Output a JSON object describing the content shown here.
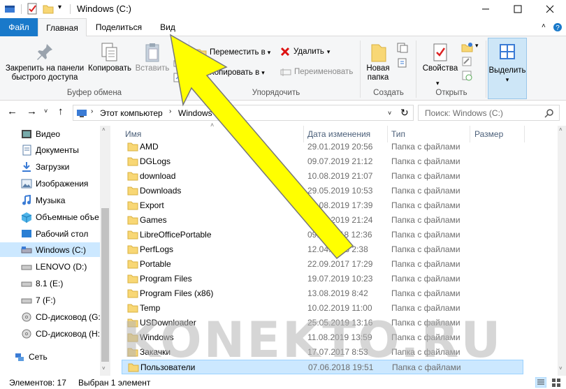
{
  "window": {
    "title": "Windows (C:)"
  },
  "tabs": {
    "file": "Файл",
    "home": "Главная",
    "share": "Поделиться",
    "view": "Вид"
  },
  "ribbon": {
    "pin": "Закрепить на панели быстрого доступа",
    "copy": "Копировать",
    "paste": "Вставить",
    "move_to": "Переместить в",
    "copy_to": "Копировать в",
    "delete": "Удалить",
    "rename": "Переименовать",
    "new_folder": "Новая папка",
    "properties": "Свойства",
    "select": "Выделить",
    "group_clipboard": "Буфер обмена",
    "group_organize": "Упорядочить",
    "group_create": "Создать",
    "group_open": "Открыть"
  },
  "address": {
    "parts": [
      "Этот компьютер",
      "Windows (C:)"
    ],
    "search_placeholder": "Поиск: Windows (C:)"
  },
  "nav": {
    "items": [
      "Видео",
      "Документы",
      "Загрузки",
      "Изображения",
      "Музыка",
      "Объемные объе",
      "Рабочий стол",
      "Windows (C:)",
      "LENOVO (D:)",
      "8.1 (E:)",
      "7 (F:)",
      "CD-дисковод (G:",
      "CD-дисковод (H:",
      "Сеть"
    ]
  },
  "columns": {
    "name": "Имя",
    "date": "Дата изменения",
    "type": "Тип",
    "size": "Размер"
  },
  "files": [
    {
      "name": "AMD",
      "date": "29.01.2019 20:56",
      "type": "Папка с файлами"
    },
    {
      "name": "DGLogs",
      "date": "09.07.2019 21:12",
      "type": "Папка с файлами"
    },
    {
      "name": "download",
      "date": "10.08.2019 21:07",
      "type": "Папка с файлами"
    },
    {
      "name": "Downloads",
      "date": "29.05.2019 10:53",
      "type": "Папка с файлами"
    },
    {
      "name": "Export",
      "date": "18.08.2019 17:39",
      "type": "Папка с файлами"
    },
    {
      "name": "Games",
      "date": "03.01.2019 21:24",
      "type": "Папка с файлами"
    },
    {
      "name": "LibreOfficePortable",
      "date": "09.11.2018 12:36",
      "type": "Папка с файлами"
    },
    {
      "name": "PerfLogs",
      "date": "12.04.2018 2:38",
      "type": "Папка с файлами"
    },
    {
      "name": "Portable",
      "date": "22.09.2017 17:29",
      "type": "Папка с файлами"
    },
    {
      "name": "Program Files",
      "date": "19.07.2019 10:23",
      "type": "Папка с файлами"
    },
    {
      "name": "Program Files (x86)",
      "date": "13.08.2019 8:42",
      "type": "Папка с файлами"
    },
    {
      "name": "Temp",
      "date": "10.02.2019 11:00",
      "type": "Папка с файлами"
    },
    {
      "name": "USDownloader",
      "date": "25.05.2019 13:16",
      "type": "Папка с файлами"
    },
    {
      "name": "Windows",
      "date": "11.08.2019 13:59",
      "type": "Папка с файлами"
    },
    {
      "name": "Закачки",
      "date": "17.07.2017 8:53",
      "type": "Папка с файлами"
    },
    {
      "name": "Пользователи",
      "date": "07.06.2018 19:51",
      "type": "Папка с файлами"
    }
  ],
  "status": {
    "count": "Элементов: 17",
    "selected": "Выбран 1 элемент"
  },
  "watermark": "KONEKTO.RU",
  "colors": {
    "file_tab": "#1979ca",
    "selection": "#cce8ff",
    "folder": "#f8d775",
    "arrow": "#ffff00"
  }
}
